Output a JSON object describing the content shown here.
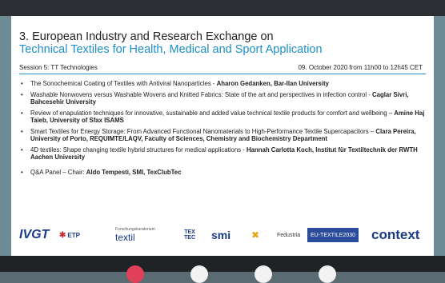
{
  "slide": {
    "title_line1": "3. European Industry and Research Exchange on",
    "title_line2": "Technical Textiles for Health, Medical and Sport Application",
    "session": "Session 5:  TT Technologies",
    "datetime": "09. October 2020 from 11h00 to 12h45 CET",
    "talks": [
      {
        "text": "The Sonochemical Coating of Textiles with Antiviral Nanoparticles - ",
        "speaker": "Aharon Gedanken, Bar-Ilan University"
      },
      {
        "text": "Washable Nonwovens versus Washable Wovens and Knitted Fabrics: State of the art and perspectives in infection control - ",
        "speaker": "Caglar Sivri, Bahcesehir University"
      },
      {
        "text": "Review of enapulation techniques for innovative, sustainable and added value technical textile products for comfort and wellbeing – ",
        "speaker": "Amine Haj Taieb, University of Sfax ISAMS"
      },
      {
        "text": "Smart Textiles for Energy Storage: From Advanced Functional Nanomaterials to High-Performance Textile Supercapacitors – ",
        "speaker": "Clara Pereira, University of Porto, REQUIMTE/LAQV, Faculty of Sciences, Chemistry and Biochemistry Department"
      },
      {
        "text": "4D textiles: Shape changing textile hybrid structures for medical applications - ",
        "speaker": "Hannah Carlotta Koch, Institut für Textiltechnik der RWTH Aachen University"
      },
      {
        "text": "Q&A Panel – Chair: ",
        "speaker": "Aldo Tempesti, SMI, TexClubTec"
      }
    ]
  },
  "logos": {
    "ivgt": "IVGT",
    "etp": "ETP",
    "textil_small": "Forschungskuratorium",
    "textil": "textil",
    "tex1": "TEX",
    "tex2": "TEC",
    "smi": "smi",
    "clusters": "✖",
    "fedustria": "Fedustria",
    "eutextile": "EU-TEXTILE2030",
    "context": "context"
  },
  "colors": {
    "accent": "#1d8fc4",
    "end_call": "#e0405a"
  }
}
